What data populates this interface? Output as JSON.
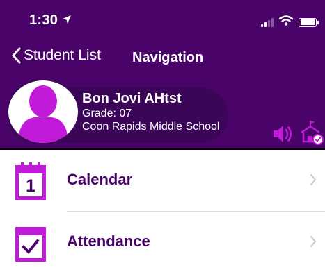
{
  "status_bar": {
    "time": "1:30"
  },
  "nav": {
    "back_label": "Student List",
    "title": "Navigation"
  },
  "student": {
    "name": "Bon Jovi AHtst",
    "grade": "Grade: 07",
    "school": "Coon Rapids Middle School"
  },
  "menu": [
    {
      "label": "Calendar",
      "icon": "calendar-icon"
    },
    {
      "label": "Attendance",
      "icon": "attendance-icon"
    }
  ],
  "calendar_day": "1",
  "colors": {
    "header": "#4a0469",
    "card": "#3b0658",
    "accent": "#c21ad9"
  }
}
